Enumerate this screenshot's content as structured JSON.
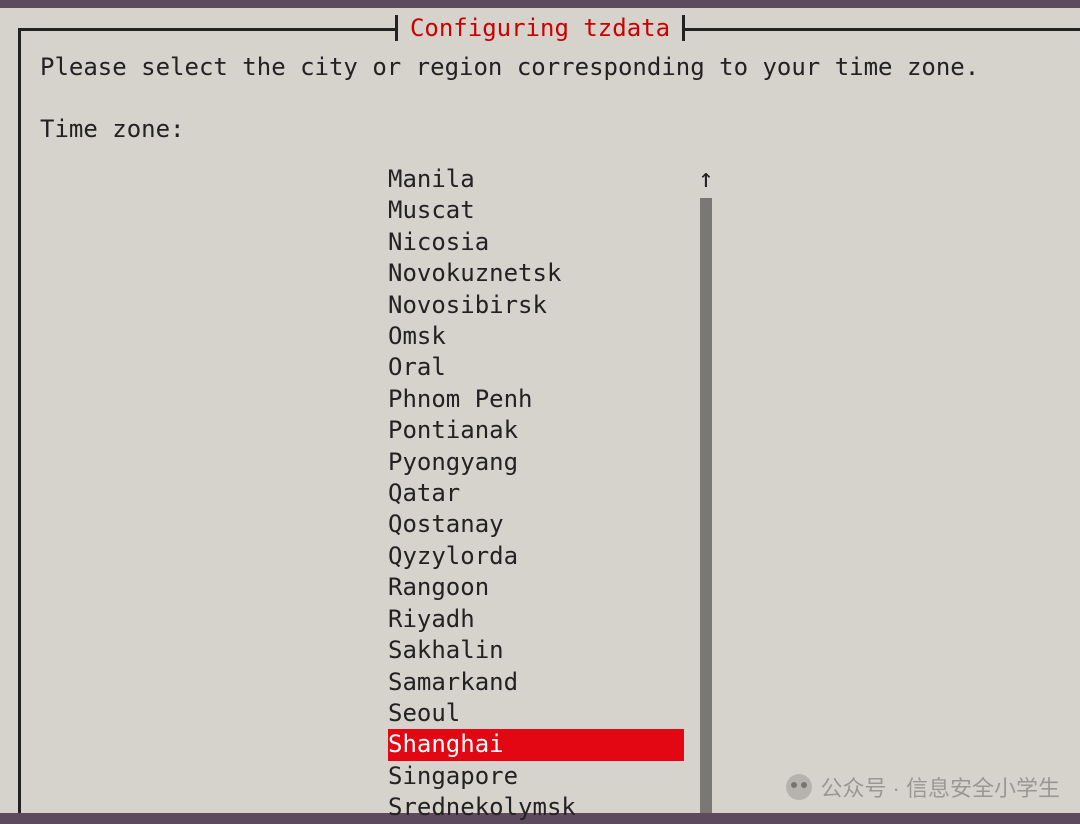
{
  "dialog": {
    "title": "Configuring tzdata",
    "prompt": "Please select the city or region corresponding to your time zone.",
    "field_label": "Time zone:"
  },
  "list": {
    "selected_index": 18,
    "items": [
      "Manila",
      "Muscat",
      "Nicosia",
      "Novokuznetsk",
      "Novosibirsk",
      "Omsk",
      "Oral",
      "Phnom Penh",
      "Pontianak",
      "Pyongyang",
      "Qatar",
      "Qostanay",
      "Qyzylorda",
      "Rangoon",
      "Riyadh",
      "Sakhalin",
      "Samarkand",
      "Seoul",
      "Shanghai",
      "Singapore",
      "Srednekolymsk"
    ]
  },
  "scroll": {
    "up_arrow": "↑"
  },
  "watermark": {
    "text": "公众号 · 信息安全小学生"
  }
}
